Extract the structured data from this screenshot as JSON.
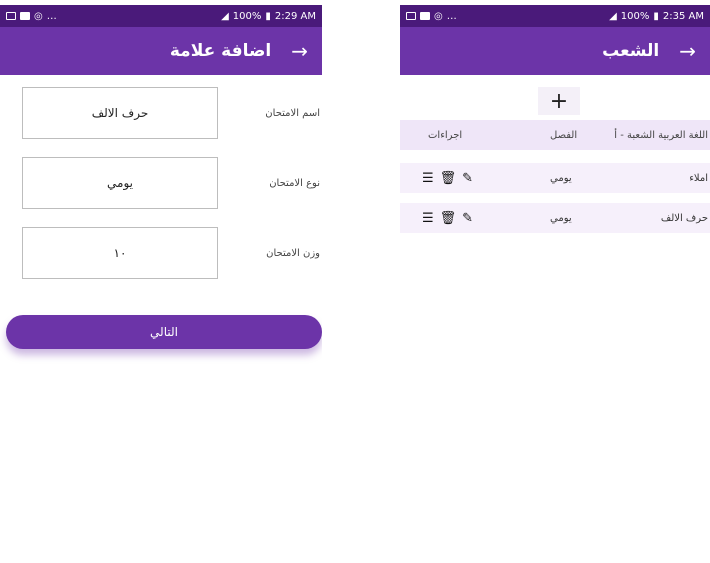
{
  "left_screen": {
    "status": {
      "battery": "100%",
      "time": "2:29 AM"
    },
    "appbar": {
      "title": "اضافة علامة",
      "back_icon": "arrow-right-icon"
    },
    "fields": [
      {
        "label": "اسم الامتحان",
        "value": "حرف الالف"
      },
      {
        "label": "نوع الامتحان",
        "value": "يومي"
      },
      {
        "label": "وزن الامتحان",
        "value": "١٠"
      }
    ],
    "next_button": "التالي"
  },
  "right_screen": {
    "status": {
      "battery": "100%",
      "time": "2:35 AM"
    },
    "appbar": {
      "title": "الشعب",
      "back_icon": "arrow-right-icon"
    },
    "add_label": "+",
    "header": {
      "name": "اللغة العربية الشعبة - أ",
      "term": "الفصل",
      "actions": "اجراءات"
    },
    "rows": [
      {
        "name": "املاء",
        "term": "يومي"
      },
      {
        "name": "حرف الالف",
        "term": "يومي"
      }
    ]
  },
  "colors": {
    "primary": "#6c34a8",
    "statusbar": "#4a1a7a",
    "row_bg": "#f6f0fb"
  }
}
